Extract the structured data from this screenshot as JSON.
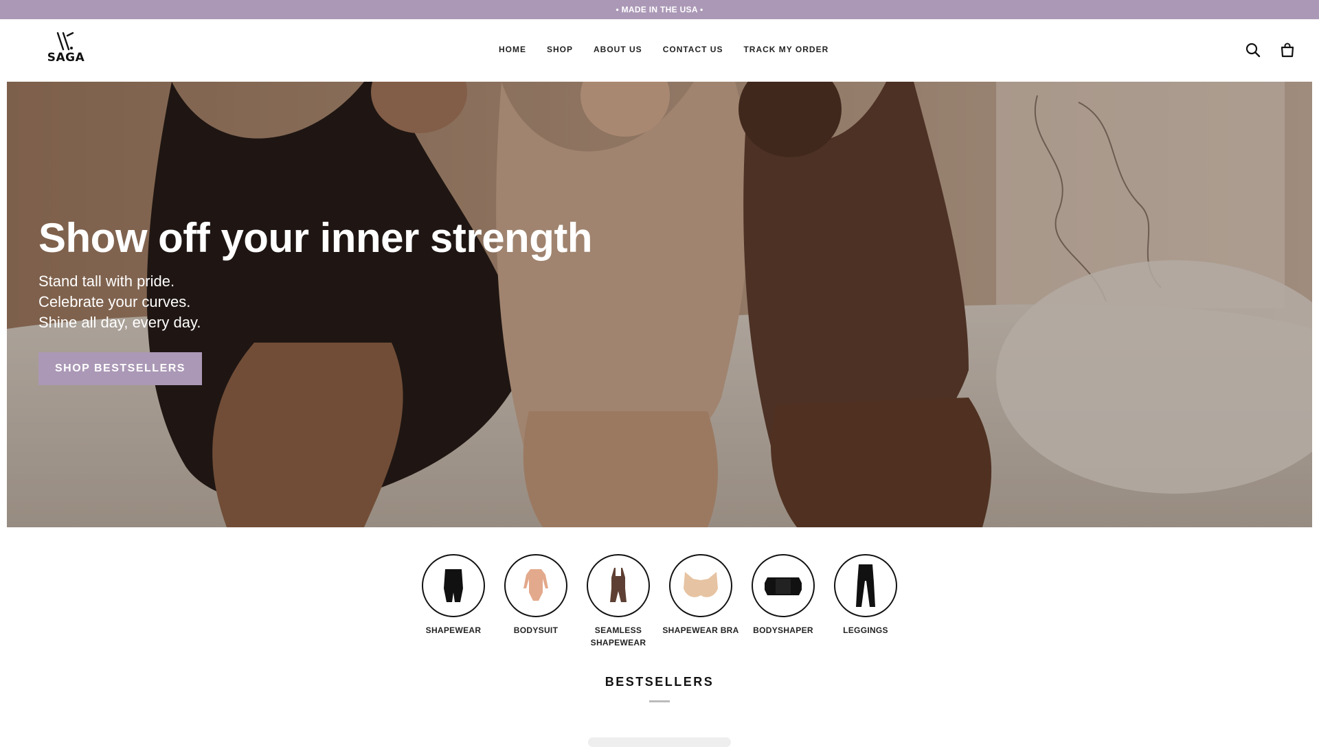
{
  "announcement": {
    "text": "• MADE IN THE USA •"
  },
  "brand": {
    "name": "SAGA"
  },
  "nav": {
    "items": [
      "HOME",
      "SHOP",
      "ABOUT US",
      "CONTACT US",
      "TRACK MY ORDER"
    ]
  },
  "header_icons": [
    "search-icon",
    "cart-icon"
  ],
  "hero": {
    "title": "Show off your inner strength",
    "lines": [
      "Stand tall with pride.",
      "Celebrate your curves.",
      "Shine all day, every day."
    ],
    "cta": "SHOP BESTSELLERS"
  },
  "categories": [
    {
      "label": "SHAPEWEAR",
      "icon": "shapewear-icon"
    },
    {
      "label": "BODYSUIT",
      "icon": "bodysuit-icon"
    },
    {
      "label": "SEAMLESS SHAPEWEAR",
      "icon": "seamless-shapewear-icon"
    },
    {
      "label": "SHAPEWEAR BRA",
      "icon": "bra-icon"
    },
    {
      "label": "BODYSHAPER",
      "icon": "bodyshaper-icon"
    },
    {
      "label": "LEGGINGS",
      "icon": "leggings-icon"
    }
  ],
  "bestsellers": {
    "title": "BESTSELLERS"
  },
  "colors": {
    "accent": "#ab98b6",
    "text": "#111111"
  }
}
